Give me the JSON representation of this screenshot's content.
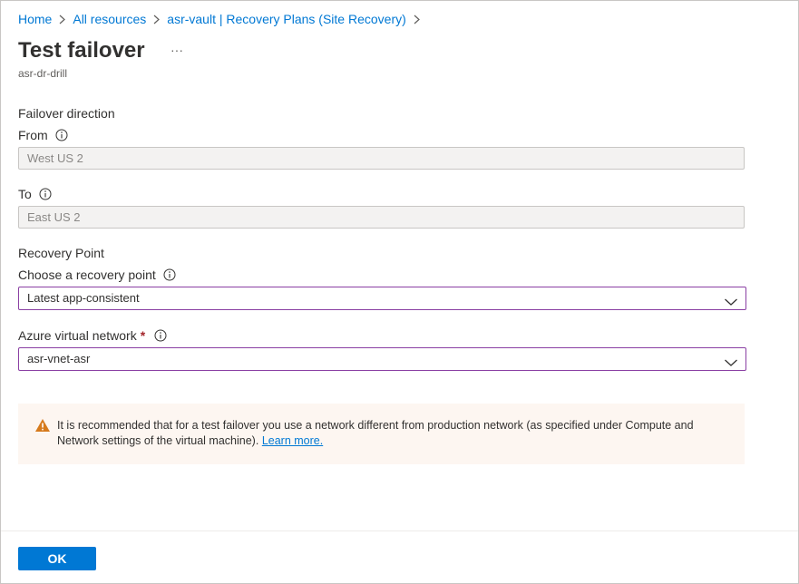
{
  "breadcrumb": {
    "items": [
      "Home",
      "All resources",
      "asr-vault | Recovery Plans (Site Recovery)"
    ]
  },
  "header": {
    "title": "Test failover",
    "more_label": "···",
    "subtitle": "asr-dr-drill"
  },
  "failover_direction": {
    "heading": "Failover direction",
    "from_label": "From",
    "from_value": "West US 2",
    "to_label": "To",
    "to_value": "East US 2"
  },
  "recovery_point": {
    "heading": "Recovery Point",
    "choose_label": "Choose a recovery point",
    "choose_value": "Latest app-consistent"
  },
  "network": {
    "label": "Azure virtual network",
    "required_mark": "*",
    "value": "asr-vnet-asr"
  },
  "warning": {
    "text": "It is recommended that for a test failover you use a network different from production network (as specified under Compute and Network settings of the virtual machine).",
    "link": "Learn more."
  },
  "footer": {
    "ok_label": "OK"
  },
  "icons": {
    "info": "info-icon",
    "warning": "warning-icon",
    "chevron": "chevron-down-icon",
    "breadcrumb_sep": "chevron-right-icon"
  },
  "colors": {
    "accent": "#0078d4",
    "focus_border": "#8a3fa3",
    "warning_icon": "#d67a1c",
    "warning_bg": "#fdf6f1",
    "required": "#a4262c"
  }
}
